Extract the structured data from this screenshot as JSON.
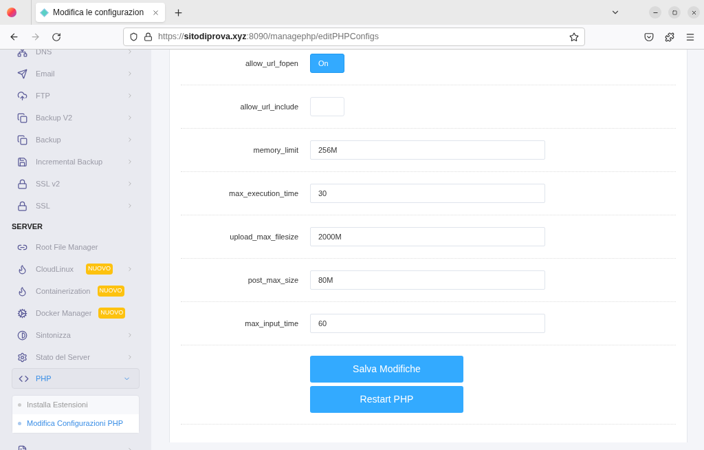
{
  "browser": {
    "tab": {
      "title": "Modifica le configurazion",
      "selected": true
    },
    "url": "https://**sitodiprova.xyz**:8090/managephp/editPHPConfigs"
  },
  "sidebar": {
    "items": [
      {
        "kind": "item",
        "label": "DNS"
      },
      {
        "kind": "item",
        "label": "Email"
      },
      {
        "kind": "item",
        "label": "FTP"
      },
      {
        "kind": "item",
        "label": "Backup V2"
      },
      {
        "kind": "item",
        "label": "Backup"
      },
      {
        "kind": "item",
        "label": "Incremental Backup"
      },
      {
        "kind": "item",
        "label": "SSL v2"
      },
      {
        "kind": "item",
        "label": "SSL"
      },
      {
        "kind": "section",
        "label": "SERVER"
      },
      {
        "kind": "item",
        "label": "Root File Manager",
        "no_chevron": true
      },
      {
        "kind": "item",
        "label": "CloudLinux",
        "badge": "NUOVO"
      },
      {
        "kind": "item",
        "label": "Containerization",
        "badge": "NUOVO"
      },
      {
        "kind": "item",
        "label": "Docker Manager",
        "badge": "NUOVO"
      },
      {
        "kind": "item",
        "label": "Sintonizza"
      },
      {
        "kind": "item",
        "label": "Stato del Server"
      },
      {
        "kind": "group",
        "label": "PHP",
        "expanded": true,
        "children": [
          {
            "label": "Installa Estensioni",
            "selected": false
          },
          {
            "label": "Modifica Configurazioni PHP",
            "selected": true
          }
        ]
      },
      {
        "kind": "item"
      }
    ]
  },
  "settings": [
    {
      "kind": "toggle",
      "label": "allow_url_fopen",
      "on": true,
      "text": "On"
    },
    {
      "kind": "toggle",
      "label": "allow_url_include",
      "on": false
    },
    {
      "kind": "text",
      "label": "memory_limit",
      "value": "256M"
    },
    {
      "kind": "text",
      "label": "max_execution_time",
      "value": "30"
    },
    {
      "kind": "text",
      "label": "upload_max_filesize",
      "value": "2000M"
    },
    {
      "kind": "text",
      "label": "post_max_size",
      "value": "80M"
    },
    {
      "kind": "text",
      "label": "max_input_time",
      "value": "60"
    }
  ],
  "buttons": [
    "Salva Modifiche",
    "Restart PHP"
  ]
}
